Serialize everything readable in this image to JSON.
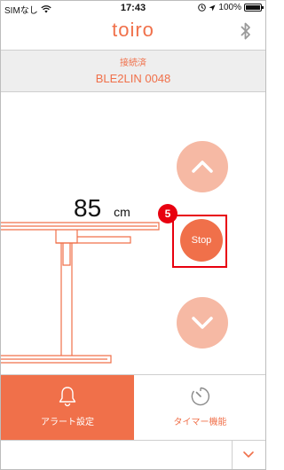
{
  "status_bar": {
    "carrier": "SIMなし",
    "time": "17:43",
    "battery_percent_label": "100%",
    "battery_level": 1.0,
    "icons": [
      "wifi-icon",
      "location-lock-icon",
      "location-arrow-icon",
      "battery-icon"
    ]
  },
  "header": {
    "title": "toiro",
    "bluetooth_icon": "bluetooth-icon"
  },
  "connection": {
    "status": "接続済",
    "device_name": "BLE2LIN 0048"
  },
  "height": {
    "value": "85",
    "unit": "cm"
  },
  "controls": {
    "up_icon": "chevron-up-icon",
    "stop_label": "Stop",
    "down_icon": "chevron-down-icon",
    "step_number": "5"
  },
  "tabs": {
    "alert_label": "アラート設定",
    "alert_icon": "bell-icon",
    "timer_label": "タイマー機能",
    "timer_icon": "timer-icon"
  },
  "footer": {
    "chevron_icon": "chevron-down-icon"
  },
  "colors": {
    "accent": "#f0704a",
    "accent_light": "#f6b9a4",
    "highlight": "#e8000f",
    "panel_bg": "#eeeeee"
  }
}
